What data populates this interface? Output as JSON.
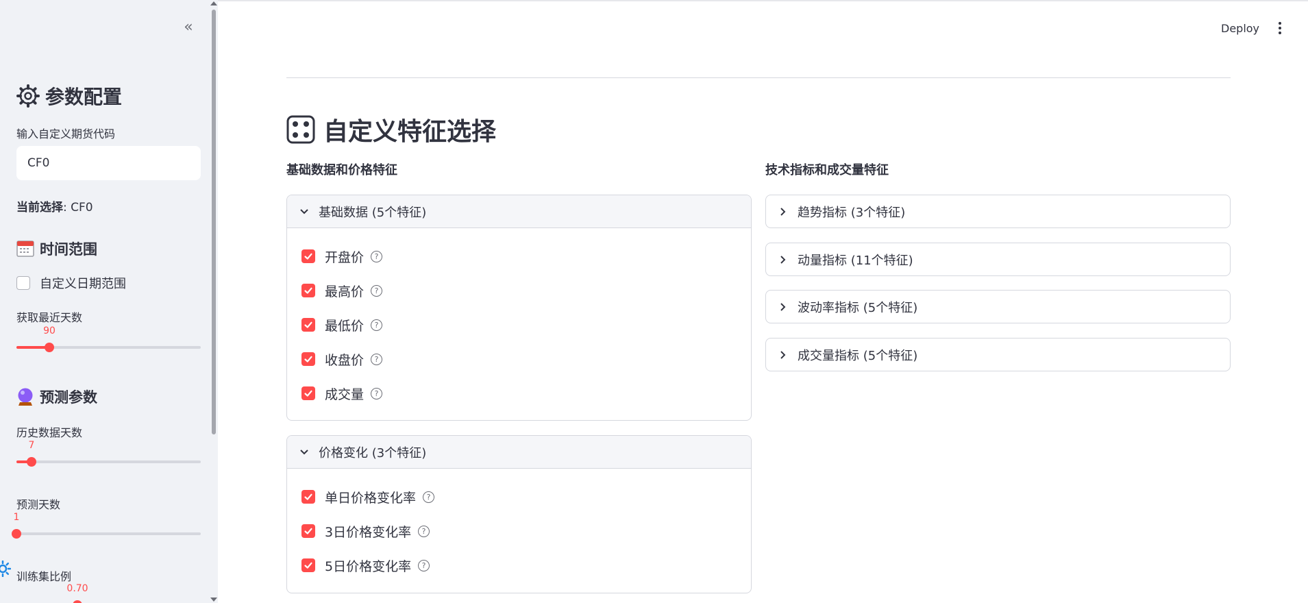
{
  "header": {
    "deploy_label": "Deploy"
  },
  "sidebar": {
    "config_title": "参数配置",
    "futures_code_label": "输入自定义期货代码",
    "futures_code_value": "CF0",
    "current_selection_label": "当前选择",
    "current_selection_value": ": CF0",
    "time_range_title": "时间范围",
    "custom_date_label": "自定义日期范围",
    "recent_days_label": "获取最近天数",
    "recent_days_value": "90",
    "predict_params_title": "预测参数",
    "history_days_label": "历史数据天数",
    "history_days_value": "7",
    "predict_days_label": "预测天数",
    "predict_days_value": "1",
    "train_ratio_label": "训练集比例",
    "train_ratio_value": "0.70"
  },
  "main": {
    "title": "自定义特征选择",
    "left_column_title": "基础数据和价格特征",
    "right_column_title": "技术指标和成交量特征",
    "basic_data": {
      "title": "基础数据 (5个特征)",
      "features": [
        "开盘价",
        "最高价",
        "最低价",
        "收盘价",
        "成交量"
      ]
    },
    "price_change": {
      "title": "价格变化 (3个特征)",
      "features": [
        "单日价格变化率",
        "3日价格变化率",
        "5日价格变化率"
      ]
    },
    "trend": {
      "title": "趋势指标 (3个特征)"
    },
    "momentum": {
      "title": "动量指标 (11个特征)"
    },
    "volatility": {
      "title": "波动率指标 (5个特征)"
    },
    "volume": {
      "title": "成交量指标 (5个特征)"
    }
  },
  "colors": {
    "accent": "#ff4b4b",
    "sidebar_bg": "#f0f2f6",
    "text": "#31333f"
  }
}
